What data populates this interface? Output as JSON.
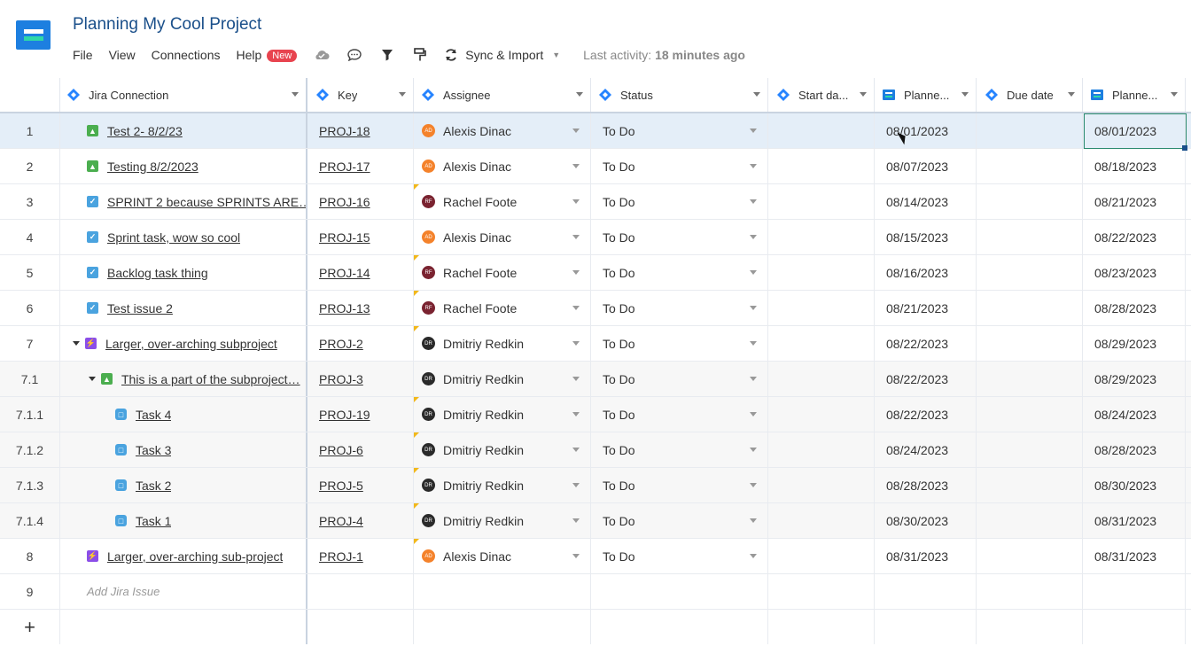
{
  "app": {
    "title": "Planning My Cool Project"
  },
  "menu": [
    "File",
    "View",
    "Connections",
    "Help"
  ],
  "help_badge": "New",
  "toolbar": {
    "icons": [
      "cloud-icon",
      "comment-icon",
      "filter-icon",
      "paint-format-icon"
    ],
    "sync_label": "Sync & Import",
    "last_activity_label": "Last activity:",
    "last_activity_value": "18 minutes ago"
  },
  "columns": [
    "Jira Connection",
    "Key",
    "Assignee",
    "Status",
    "Start da...",
    "Planne...",
    "Due date",
    "Planne..."
  ],
  "rows": [
    {
      "num": "1",
      "level": 0,
      "caret": false,
      "type": "story",
      "summary": "Test 2- 8/2/23",
      "key": "PROJ-18",
      "assignee": "Alexis Dinac",
      "av": "AD",
      "flag": false,
      "status": "To Do",
      "planned_start": "08/01/2023",
      "planned_end": "08/01/2023"
    },
    {
      "num": "2",
      "level": 0,
      "caret": false,
      "type": "story",
      "summary": "Testing 8/2/2023",
      "key": "PROJ-17",
      "assignee": "Alexis Dinac",
      "av": "AD",
      "flag": false,
      "status": "To Do",
      "planned_start": "08/07/2023",
      "planned_end": "08/18/2023"
    },
    {
      "num": "3",
      "level": 0,
      "caret": false,
      "type": "task",
      "summary": "SPRINT 2 because SPRINTS ARE…",
      "key": "PROJ-16",
      "assignee": "Rachel Foote",
      "av": "RF",
      "flag": true,
      "status": "To Do",
      "planned_start": "08/14/2023",
      "planned_end": "08/21/2023"
    },
    {
      "num": "4",
      "level": 0,
      "caret": false,
      "type": "task",
      "summary": "Sprint task, wow so cool",
      "key": "PROJ-15",
      "assignee": "Alexis Dinac",
      "av": "AD",
      "flag": false,
      "status": "To Do",
      "planned_start": "08/15/2023",
      "planned_end": "08/22/2023"
    },
    {
      "num": "5",
      "level": 0,
      "caret": false,
      "type": "task",
      "summary": "Backlog task thing",
      "key": "PROJ-14",
      "assignee": "Rachel Foote",
      "av": "RF",
      "flag": true,
      "status": "To Do",
      "planned_start": "08/16/2023",
      "planned_end": "08/23/2023"
    },
    {
      "num": "6",
      "level": 0,
      "caret": false,
      "type": "task",
      "summary": "Test issue 2",
      "key": "PROJ-13",
      "assignee": "Rachel Foote",
      "av": "RF",
      "flag": true,
      "status": "To Do",
      "planned_start": "08/21/2023",
      "planned_end": "08/28/2023"
    },
    {
      "num": "7",
      "level": 0,
      "caret": true,
      "type": "epic",
      "summary": "Larger, over-arching subproject",
      "key": "PROJ-2",
      "assignee": "Dmitriy Redkin",
      "av": "DR",
      "flag": true,
      "status": "To Do",
      "planned_start": "08/22/2023",
      "planned_end": "08/29/2023"
    },
    {
      "num": "7.1",
      "level": 1,
      "caret": true,
      "type": "story",
      "summary": "This is a part of the subproject…",
      "key": "PROJ-3",
      "assignee": "Dmitriy Redkin",
      "av": "DR",
      "flag": false,
      "status": "To Do",
      "planned_start": "08/22/2023",
      "planned_end": "08/29/2023"
    },
    {
      "num": "7.1.1",
      "level": 2,
      "caret": false,
      "type": "sub",
      "summary": "Task 4",
      "key": "PROJ-19",
      "assignee": "Dmitriy Redkin",
      "av": "DR",
      "flag": true,
      "status": "To Do",
      "planned_start": "08/22/2023",
      "planned_end": "08/24/2023"
    },
    {
      "num": "7.1.2",
      "level": 2,
      "caret": false,
      "type": "sub",
      "summary": "Task 3",
      "key": "PROJ-6",
      "assignee": "Dmitriy Redkin",
      "av": "DR",
      "flag": true,
      "status": "To Do",
      "planned_start": "08/24/2023",
      "planned_end": "08/28/2023"
    },
    {
      "num": "7.1.3",
      "level": 2,
      "caret": false,
      "type": "sub",
      "summary": "Task 2",
      "key": "PROJ-5",
      "assignee": "Dmitriy Redkin",
      "av": "DR",
      "flag": true,
      "status": "To Do",
      "planned_start": "08/28/2023",
      "planned_end": "08/30/2023"
    },
    {
      "num": "7.1.4",
      "level": 2,
      "caret": false,
      "type": "sub",
      "summary": "Task 1",
      "key": "PROJ-4",
      "assignee": "Dmitriy Redkin",
      "av": "DR",
      "flag": true,
      "status": "To Do",
      "planned_start": "08/30/2023",
      "planned_end": "08/31/2023"
    },
    {
      "num": "8",
      "level": 0,
      "caret": false,
      "type": "epic",
      "summary": "Larger, over-arching sub-project",
      "key": "PROJ-1",
      "assignee": "Alexis Dinac",
      "av": "AD",
      "flag": true,
      "status": "To Do",
      "planned_start": "08/31/2023",
      "planned_end": "08/31/2023"
    }
  ],
  "add_row": {
    "num": "9",
    "placeholder": "Add Jira Issue"
  },
  "plus_label": "+"
}
